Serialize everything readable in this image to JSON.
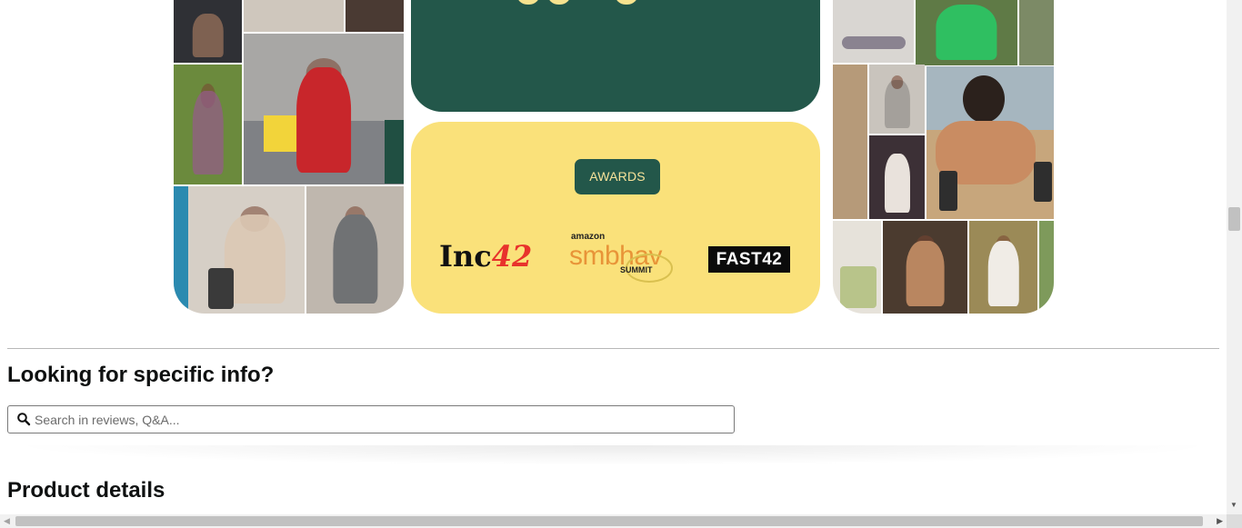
{
  "awards": {
    "badge_label": "AWARDS",
    "logos": {
      "inc_prefix": "Inc",
      "inc_number": "42",
      "amazon_small": "amazon",
      "amazon_big": "smbhav",
      "amazon_summit": "SUMMIT",
      "fast42": "FAST42"
    }
  },
  "info_section": {
    "heading": "Looking for specific info?",
    "search_placeholder": "Search in reviews, Q&A..."
  },
  "product_details": {
    "heading": "Product details"
  },
  "icons": [
    "search-icon",
    "scroll-down-arrow-icon",
    "scroll-left-arrow-icon",
    "scroll-right-arrow-icon"
  ],
  "colors": {
    "dark_green": "#23574a",
    "yellow": "#fae17a",
    "badge_text": "#f6e29a",
    "inc_red": "#e8322c",
    "amazon_orange": "#e89438"
  }
}
